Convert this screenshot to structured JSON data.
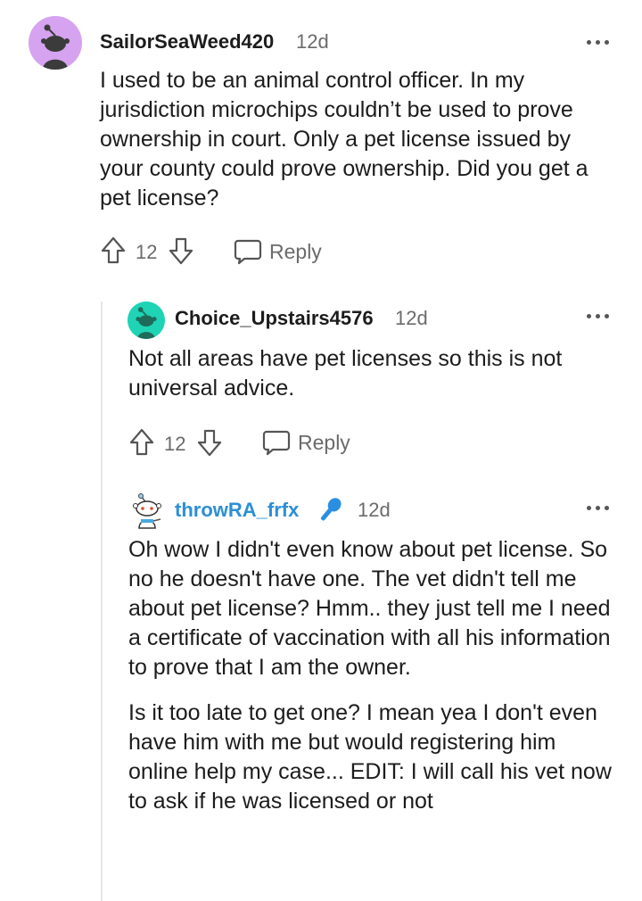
{
  "comments": [
    {
      "username": "SailorSeaWeed420",
      "timestamp": "12d",
      "avatar_icon": "snoo-avatar-purple",
      "body": [
        "I used to be an animal control officer. In my jurisdiction microchips couldn’t be used to prove ownership in court. Only a pet license issued by your county could prove ownership. Did you get a pet license?"
      ],
      "votes": "12",
      "reply_label": "Reply"
    },
    {
      "username": "Choice_Upstairs4576",
      "timestamp": "12d",
      "avatar_icon": "snoo-avatar-teal",
      "body": [
        "Not all areas have pet licenses so this is not universal advice."
      ],
      "votes": "12",
      "reply_label": "Reply"
    },
    {
      "username": "throwRA_frfx",
      "timestamp": "12d",
      "avatar_icon": "snoo-avatar-custom",
      "badge_icon": "microphone-icon",
      "body": [
        "Oh wow I didn't even know about pet license. So no he doesn't have one. The vet didn't tell me about pet license? Hmm.. they just tell me I need a certificate of vaccination with all his information to prove that I am the owner.",
        "Is it too late to get one? I mean yea I don't even have him with me but would registering him online help my case... EDIT: I will call his vet now to ask if he was licensed or not"
      ]
    }
  ],
  "colors": {
    "text": "#1c1c1c",
    "meta": "#6b6b6b",
    "op_username": "#2b8fd6",
    "avatar_purple": "#d6a3f0",
    "avatar_teal": "#1fd3b5",
    "thread_line": "#e6e6e6"
  }
}
